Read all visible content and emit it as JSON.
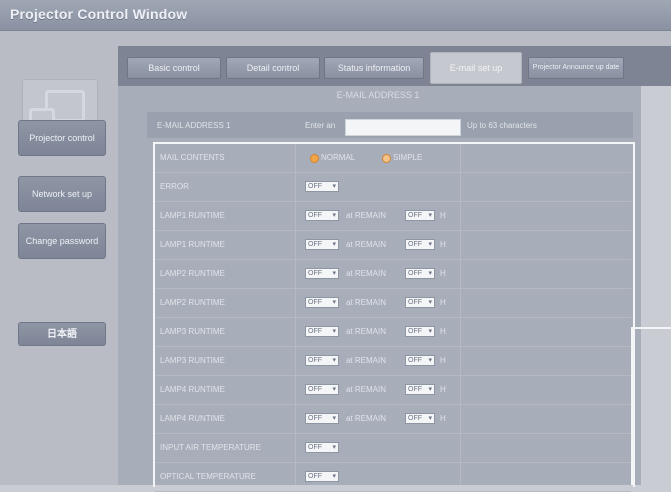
{
  "window": {
    "title": "Projector Control Window"
  },
  "sidebar": {
    "items": [
      {
        "label": "Projector control"
      },
      {
        "label": "Network set up"
      },
      {
        "label": "Change password"
      },
      {
        "label": "日本語"
      }
    ]
  },
  "tabs": [
    {
      "label": "Basic control"
    },
    {
      "label": "Detail control"
    },
    {
      "label": "Status information"
    },
    {
      "label": "E-mail set up"
    },
    {
      "label": "Projector Announce up date"
    }
  ],
  "section": {
    "title": "E-MAIL ADDRESS 1"
  },
  "email": {
    "label": "E-MAIL ADDRESS 1",
    "field_label": "Enter an",
    "value": "",
    "hint": "Up to 63 characters"
  },
  "table": {
    "rows": [
      {
        "label": "MAIL CONTENTS",
        "type": "radio",
        "options": [
          "NORMAL",
          "SIMPLE"
        ]
      },
      {
        "label": "ERROR",
        "type": "select",
        "value": "OFF"
      },
      {
        "label": "LAMP1 RUNTIME",
        "type": "select2",
        "value": "OFF",
        "at": "at REMAIN",
        "value2": "OFF",
        "unit": "H"
      },
      {
        "label": "LAMP1 RUNTIME",
        "type": "select2",
        "value": "OFF",
        "at": "at REMAIN",
        "value2": "OFF",
        "unit": "H"
      },
      {
        "label": "LAMP2 RUNTIME",
        "type": "select2",
        "value": "OFF",
        "at": "at REMAIN",
        "value2": "OFF",
        "unit": "H"
      },
      {
        "label": "LAMP2 RUNTIME",
        "type": "select2",
        "value": "OFF",
        "at": "at REMAIN",
        "value2": "OFF",
        "unit": "H"
      },
      {
        "label": "LAMP3 RUNTIME",
        "type": "select2",
        "value": "OFF",
        "at": "at REMAIN",
        "value2": "OFF",
        "unit": "H"
      },
      {
        "label": "LAMP3 RUNTIME",
        "type": "select2",
        "value": "OFF",
        "at": "at REMAIN",
        "value2": "OFF",
        "unit": "H"
      },
      {
        "label": "LAMP4 RUNTIME",
        "type": "select2",
        "value": "OFF",
        "at": "at REMAIN",
        "value2": "OFF",
        "unit": "H"
      },
      {
        "label": "LAMP4 RUNTIME",
        "type": "select2",
        "value": "OFF",
        "at": "at REMAIN",
        "value2": "OFF",
        "unit": "H"
      },
      {
        "label": "INPUT AIR TEMPERATURE",
        "type": "select",
        "value": "OFF"
      },
      {
        "label": "OPTICAL TEMPERATURE",
        "type": "select",
        "value": "OFF"
      }
    ]
  }
}
